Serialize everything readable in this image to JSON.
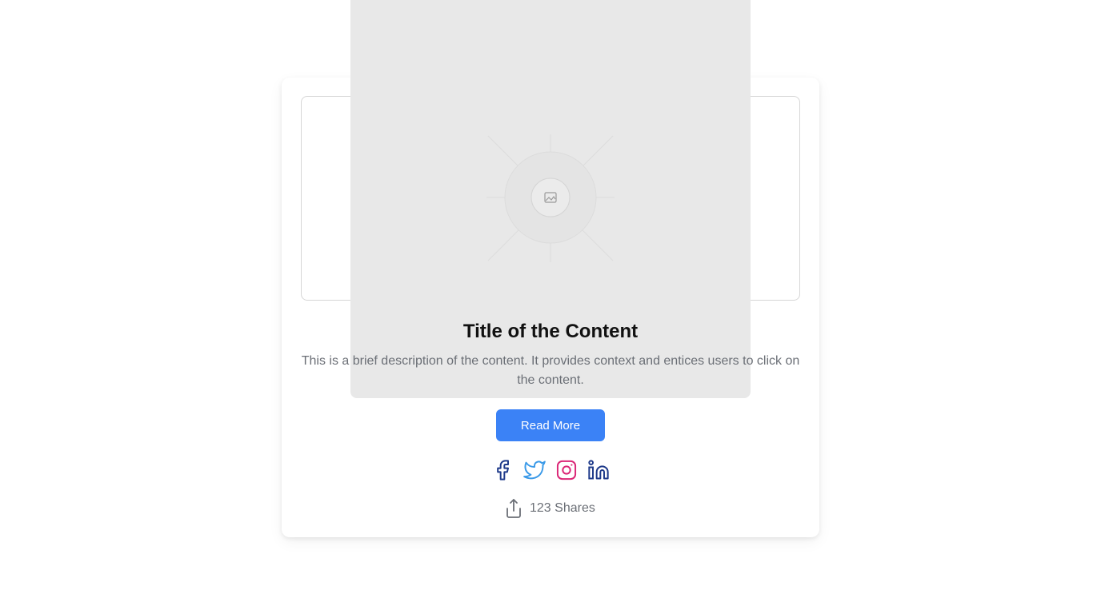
{
  "content": {
    "title": "Title of the Content",
    "description": "This is a brief description of the content. It provides context and entices users to click on the content.",
    "read_more_label": "Read More"
  },
  "social": [
    {
      "name": "facebook",
      "icon": "facebook-icon",
      "color": "#1e3a8a"
    },
    {
      "name": "twitter",
      "icon": "twitter-icon",
      "color": "#3b9ae8"
    },
    {
      "name": "instagram",
      "icon": "instagram-icon",
      "color": "#db2777"
    },
    {
      "name": "linkedin",
      "icon": "linkedin-icon",
      "color": "#1e3a8a"
    }
  ],
  "shares": {
    "icon": "share-icon",
    "text": "123 Shares"
  },
  "colors": {
    "accent": "#3b82f6",
    "placeholder_bg": "#e8e8e8",
    "muted_text": "#6b6f76"
  }
}
